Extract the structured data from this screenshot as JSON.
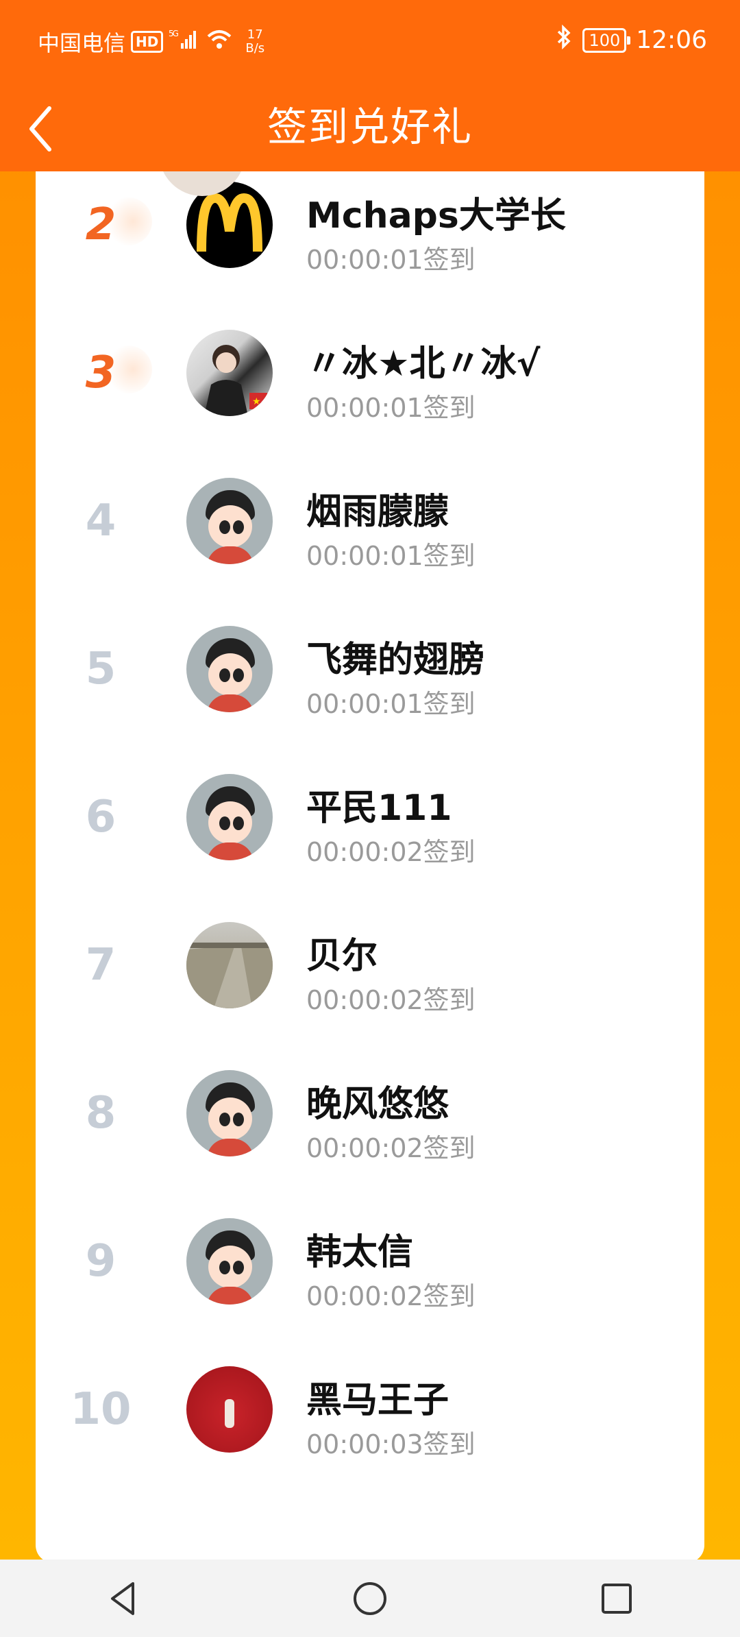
{
  "status_bar": {
    "carrier": "中国电信",
    "hd": "HD",
    "network": "5G",
    "net_speed_value": "17",
    "net_speed_unit": "B/s",
    "battery": "100",
    "time": "12:06"
  },
  "header": {
    "title": "签到兑好礼"
  },
  "checkins": [
    {
      "rank": "2",
      "name": "Mchaps大学长",
      "time": "00:00:01签到",
      "avatar": "mcdonalds-logo"
    },
    {
      "rank": "3",
      "name": "〃冰★北〃冰√",
      "time": "00:00:01签到",
      "avatar": "photo-man-suit"
    },
    {
      "rank": "4",
      "name": "烟雨朦朦",
      "time": "00:00:01签到",
      "avatar": "default-cartoon"
    },
    {
      "rank": "5",
      "name": "飞舞的翅膀",
      "time": "00:00:01签到",
      "avatar": "default-cartoon"
    },
    {
      "rank": "6",
      "name": "平民111",
      "time": "00:00:02签到",
      "avatar": "default-cartoon"
    },
    {
      "rank": "7",
      "name": "贝尔",
      "time": "00:00:02签到",
      "avatar": "photo-road"
    },
    {
      "rank": "8",
      "name": "晚风悠悠",
      "time": "00:00:02签到",
      "avatar": "default-cartoon"
    },
    {
      "rank": "9",
      "name": "韩太信",
      "time": "00:00:02签到",
      "avatar": "default-cartoon"
    },
    {
      "rank": "10",
      "name": "黑马王子",
      "time": "00:00:03签到",
      "avatar": "photo-red-wall"
    }
  ],
  "colors": {
    "header_bg": "#FF6A0B",
    "page_bg_top": "#FF8C00",
    "page_bg_bottom": "#FFB800",
    "top_rank": "#F26522",
    "rank": "#C6CDD6",
    "time_text": "#9A9A9A"
  }
}
